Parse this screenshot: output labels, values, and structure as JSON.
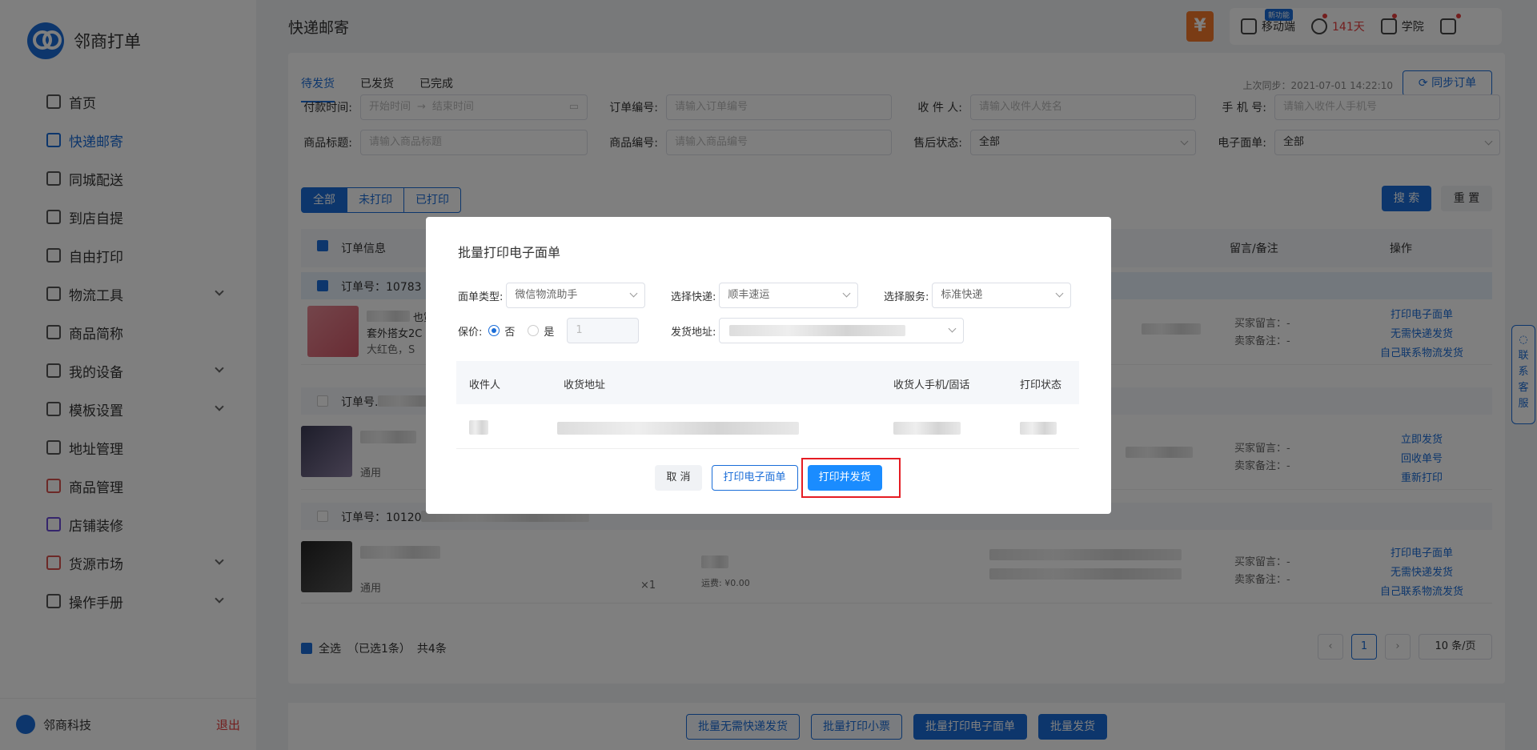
{
  "app": {
    "name": "邻商打单"
  },
  "sidebar": {
    "items": [
      {
        "label": "首页",
        "icon": "home-icon"
      },
      {
        "label": "快递邮寄",
        "icon": "document-icon",
        "active": true
      },
      {
        "label": "同城配送",
        "icon": "person-icon"
      },
      {
        "label": "到店自提",
        "icon": "store-icon"
      },
      {
        "label": "自由打印",
        "icon": "printer-icon"
      },
      {
        "label": "物流工具",
        "icon": "truck-icon",
        "expandable": true
      },
      {
        "label": "商品简称",
        "icon": "text-icon"
      },
      {
        "label": "我的设备",
        "icon": "device-icon",
        "expandable": true
      },
      {
        "label": "模板设置",
        "icon": "template-icon",
        "expandable": true
      },
      {
        "label": "地址管理",
        "icon": "location-icon"
      },
      {
        "label": "商品管理",
        "icon": "goods-icon"
      },
      {
        "label": "店铺装修",
        "icon": "decorate-icon"
      },
      {
        "label": "货源市场",
        "icon": "market-icon",
        "expandable": true
      },
      {
        "label": "操作手册",
        "icon": "manual-icon",
        "expandable": true
      }
    ],
    "company": "邻商科技",
    "logout": "退出"
  },
  "header": {
    "title": "快递邮寄",
    "mobile": "移动端",
    "new_tag": "新功能",
    "days": "141天",
    "academy": "学院"
  },
  "tabs": [
    "待发货",
    "已发货",
    "已完成"
  ],
  "sync": {
    "last": "上次同步：2021-07-01 14:22:10",
    "button": "同步订单"
  },
  "filters": {
    "pay_time": "付款时间:",
    "start": "开始时间",
    "arrow": "→",
    "end": "结束时间",
    "order_no": "订单编号:",
    "order_no_ph": "请输入订单编号",
    "receiver": "收 件 人:",
    "receiver_ph": "请输入收件人姓名",
    "phone": "手 机 号:",
    "phone_ph": "请输入收件人手机号",
    "goods_title": "商品标题:",
    "goods_title_ph": "请输入商品标题",
    "goods_no": "商品编号:",
    "goods_no_ph": "请输入商品编号",
    "after_sale": "售后状态:",
    "after_sale_val": "全部",
    "esheet": "电子面单:",
    "esheet_val": "全部",
    "segments": [
      "全部",
      "未打印",
      "已打印"
    ],
    "search": "搜 索",
    "reset": "重 置"
  },
  "table": {
    "headers": {
      "order_info": "订单信息",
      "remark": "留言/备注",
      "ops": "操作"
    },
    "orders": [
      {
        "no": "订单号：10783",
        "line1": "套外搭女2C",
        "spec": "大红色，S",
        "partial": "也霓",
        "buyer_msg": "买家留言：-",
        "seller_note": "卖家备注：-",
        "ops": [
          "打印电子面单",
          "无需快递发货",
          "自己联系物流发货"
        ]
      },
      {
        "no": "订单号.",
        "spec": "通用",
        "buyer_msg": "买家留言：-",
        "seller_note": "卖家备注：-",
        "ops": [
          "立即发货",
          "回收单号",
          "重新打印"
        ]
      },
      {
        "no": "订单号：10120",
        "spec": "通用",
        "qty": "×1",
        "freight": "运费: ¥0.00",
        "buyer_msg": "买家留言：-",
        "seller_note": "卖家备注：-",
        "ops": [
          "打印电子面单",
          "无需快递发货",
          "自己联系物流发货"
        ]
      }
    ]
  },
  "footer": {
    "select_all": "全选",
    "selected": "（已选1条）",
    "total": "共4条",
    "page": "1",
    "page_size": "10 条/页"
  },
  "bottom_actions": [
    "批量无需快递发货",
    "批量打印小票",
    "批量打印电子面单",
    "批量发货"
  ],
  "kefu": "联系客服",
  "modal": {
    "title": "批量打印电子面单",
    "sheet_type_label": "面单类型:",
    "sheet_type": "微信物流助手",
    "express_label": "选择快递:",
    "express": "顺丰速运",
    "service_label": "选择服务:",
    "service": "标准快递",
    "insure_label": "保价:",
    "no": "否",
    "yes": "是",
    "insure_value": "1",
    "addr_label": "发货地址:",
    "cols": [
      "收件人",
      "收货地址",
      "收货人手机/固话",
      "打印状态"
    ],
    "cancel": "取 消",
    "print": "打印电子面单",
    "print_ship": "打印并发货"
  }
}
